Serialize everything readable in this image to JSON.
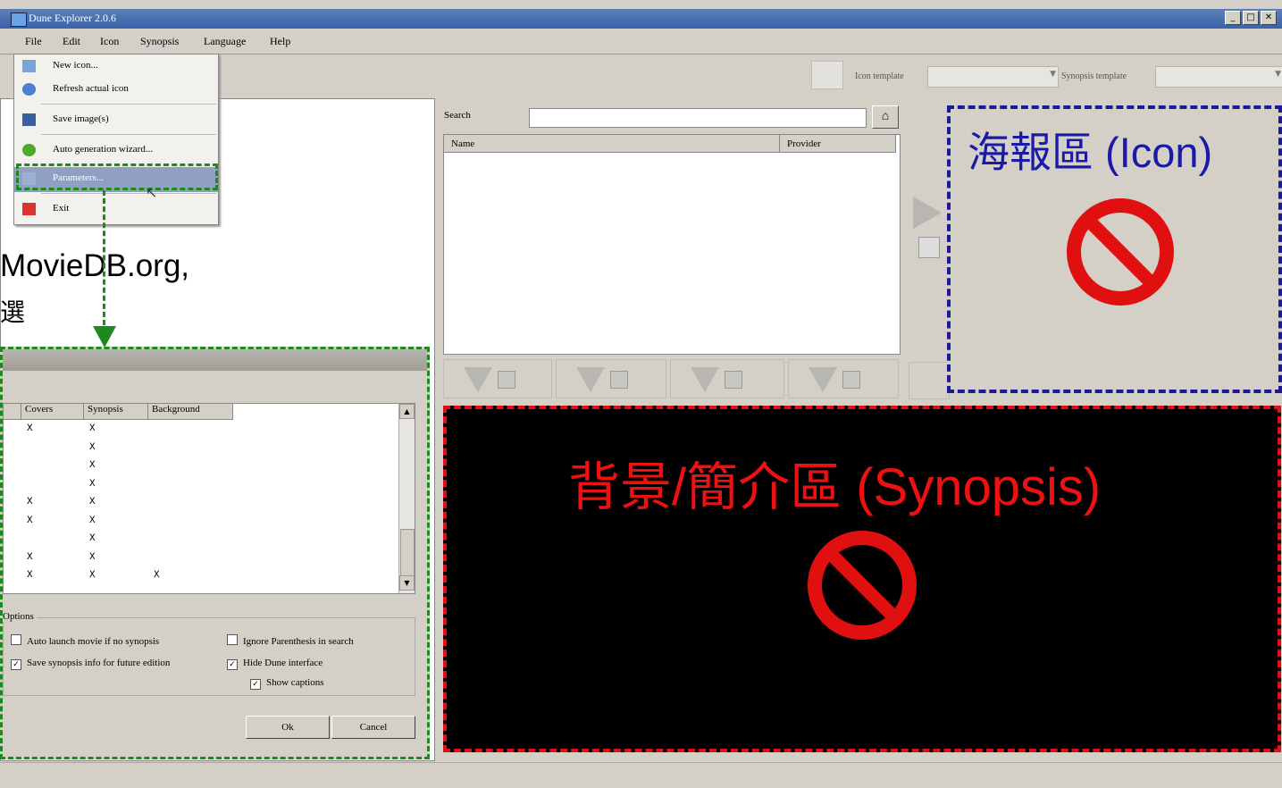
{
  "window": {
    "title": "Dune Explorer 2.0.6"
  },
  "menubar": {
    "items": [
      "File",
      "Edit",
      "Icon",
      "Synopsis",
      "Language",
      "Help"
    ]
  },
  "file_menu": {
    "items": [
      {
        "label": "New icon...",
        "icon": "folder-icon"
      },
      {
        "label": "Refresh actual icon",
        "icon": "refresh-icon"
      },
      {
        "label": "Save image(s)",
        "icon": "save-icon"
      },
      {
        "label": "Auto generation wizard...",
        "icon": "wizard-icon"
      },
      {
        "label": "Parameters...",
        "icon": "parameters-icon"
      },
      {
        "label": "Exit",
        "icon": "exit-icon"
      }
    ]
  },
  "toolbar": {
    "icon_template_label": "Icon template",
    "synopsis_template_label": "Synopsis template"
  },
  "search": {
    "label": "Search",
    "search_button_icon": "home-icon"
  },
  "results": {
    "columns": [
      "Name",
      "Provider"
    ]
  },
  "annotations": {
    "left_line1": "MovieDB.org,",
    "left_line2": "選",
    "icon_area": "海報區 (Icon)",
    "synopsis_area": "背景/簡介區 (Synopsis)"
  },
  "colors": {
    "icon_box": "#1a1a9a",
    "synopsis_box": "#e01010",
    "params_box": "#1c8a1c",
    "no_sign": "#e01010"
  },
  "dialog": {
    "columns": [
      "Covers",
      "Synopsis",
      "Background"
    ],
    "rows": [
      [
        "X",
        "X",
        ""
      ],
      [
        "",
        "X",
        ""
      ],
      [
        "",
        "X",
        ""
      ],
      [
        "",
        "X",
        ""
      ],
      [
        "X",
        "X",
        ""
      ],
      [
        "X",
        "X",
        ""
      ],
      [
        "",
        "X",
        ""
      ],
      [
        "X",
        "X",
        ""
      ],
      [
        "X",
        "X",
        "X"
      ]
    ],
    "options_label": "Options",
    "options": [
      {
        "label": "Auto launch movie if no synopsis",
        "checked": false
      },
      {
        "label": "Ignore Parenthesis in search",
        "checked": false
      },
      {
        "label": "Save synopsis info for future edition",
        "checked": true
      },
      {
        "label": "Hide Dune interface",
        "checked": true
      },
      {
        "label": "Show captions",
        "checked": true
      }
    ],
    "ok_label": "Ok",
    "cancel_label": "Cancel"
  }
}
